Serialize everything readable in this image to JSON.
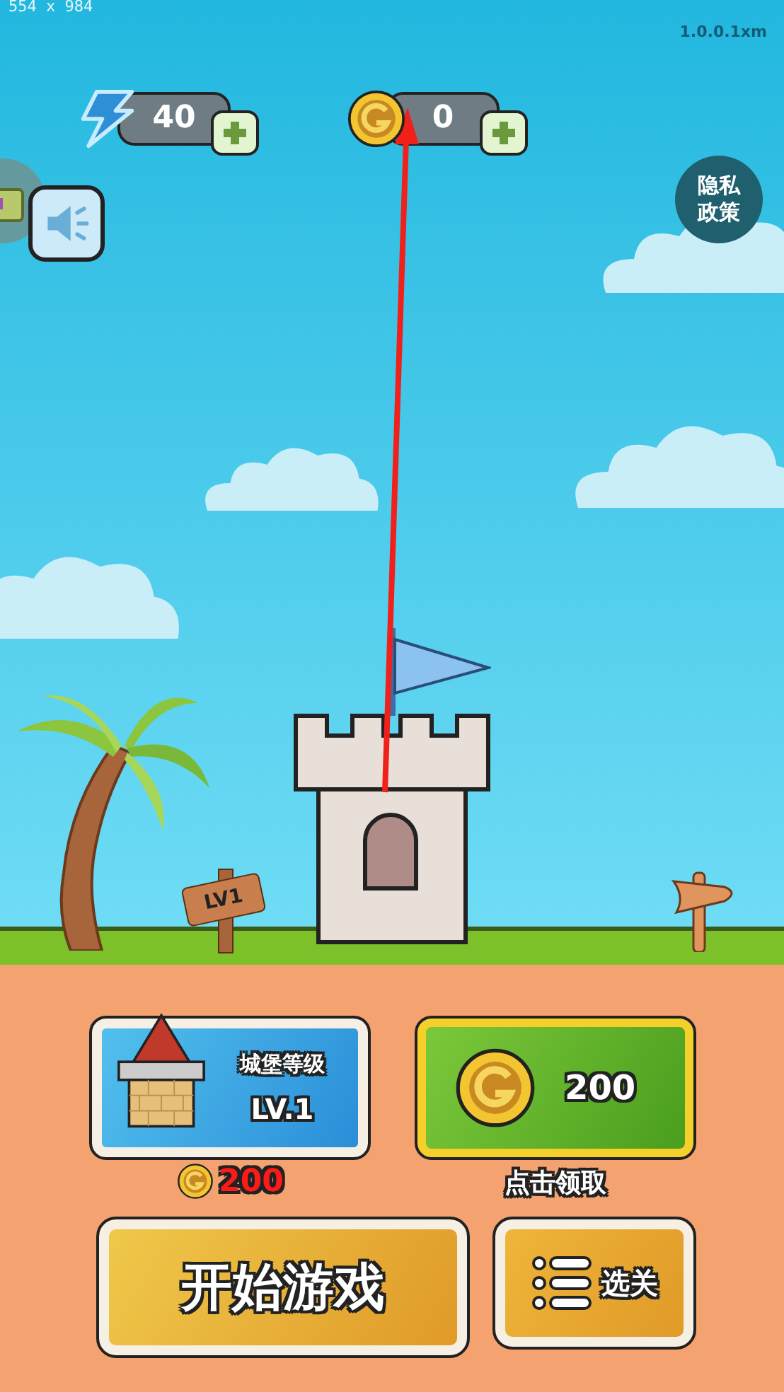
{
  "size_label": "554 x 984",
  "version": "1.0.0.1xm",
  "resources": [
    {
      "kind": "energy",
      "value": "40"
    },
    {
      "kind": "coin",
      "value": "0"
    }
  ],
  "privacy_button": {
    "label": "隐私政策"
  },
  "level_sign": {
    "label": "LV1"
  },
  "castle_upgrade": {
    "title": "城堡等级",
    "grade": "LV.1",
    "cost": "200"
  },
  "reward": {
    "amount": "200",
    "label": "点击领取"
  },
  "buttons": {
    "start": "开始游戏",
    "select": "选关"
  }
}
